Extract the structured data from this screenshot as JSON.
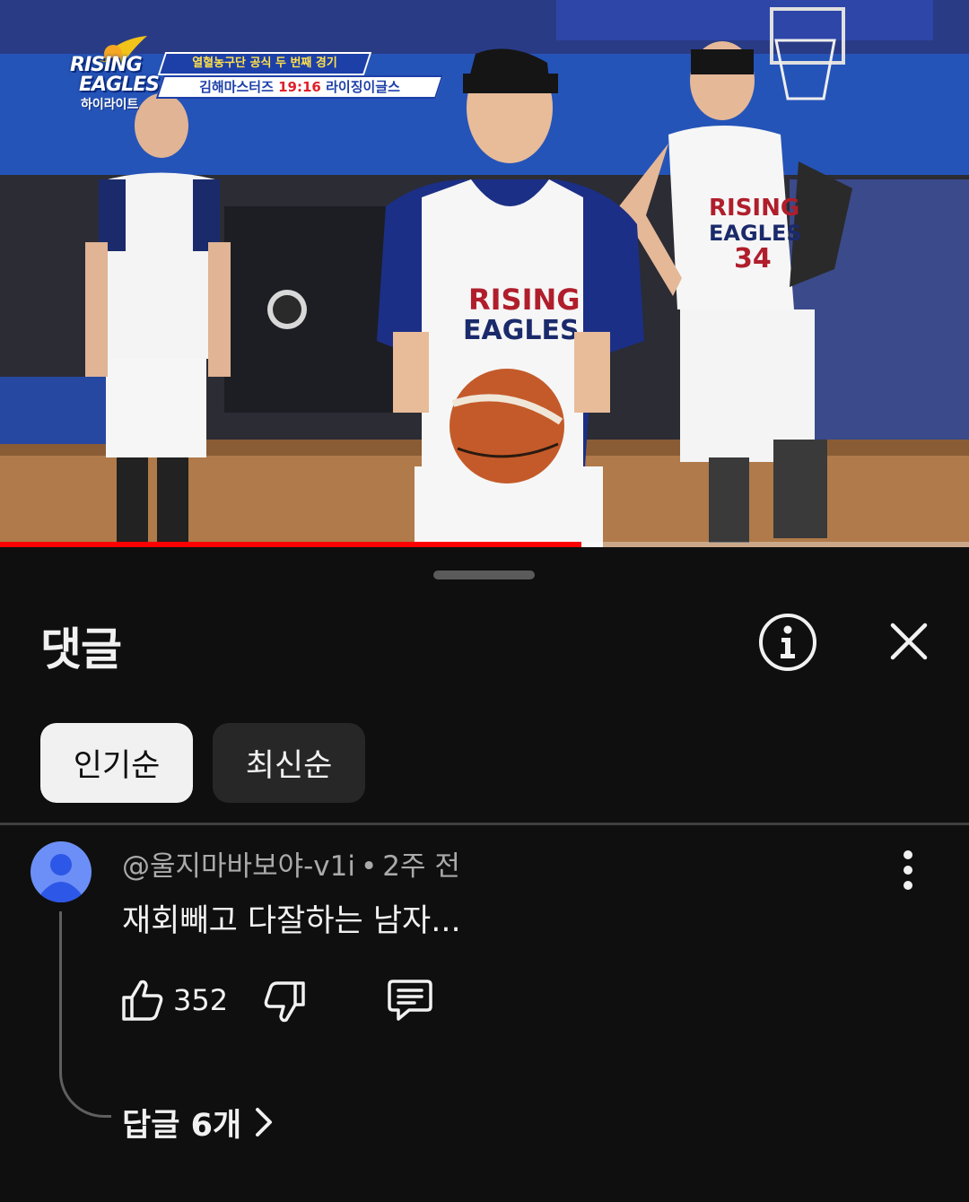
{
  "video": {
    "overlay": {
      "logo_line1": "RISING",
      "logo_line2": "EAGLES",
      "logo_line3": "하이라이트",
      "banner_top": "열혈농구단 공식 두 번째 경기",
      "banner_team_left": "김해마스터즈",
      "banner_score": "19:16",
      "banner_team_right": "라이징이글스"
    },
    "progress_fraction": 0.6
  },
  "sheet": {
    "title": "댓글",
    "info_icon": "info-icon",
    "close_icon": "close-icon"
  },
  "sort_chips": {
    "popular": "인기순",
    "newest": "최신순",
    "selected": "popular"
  },
  "comment": {
    "author": "@울지마바보야-v1i",
    "separator": "•",
    "time": "2주 전",
    "text": "재회빼고 다잘하는 남자...",
    "like_count": "352",
    "replies_label": "답글 6개"
  },
  "colors": {
    "background": "#0f0f0f",
    "chip_selected_bg": "#f1f1f1",
    "chip_bg": "#272727",
    "avatar_bg": "#6c8ff7",
    "text_secondary": "#aaaaaa"
  }
}
